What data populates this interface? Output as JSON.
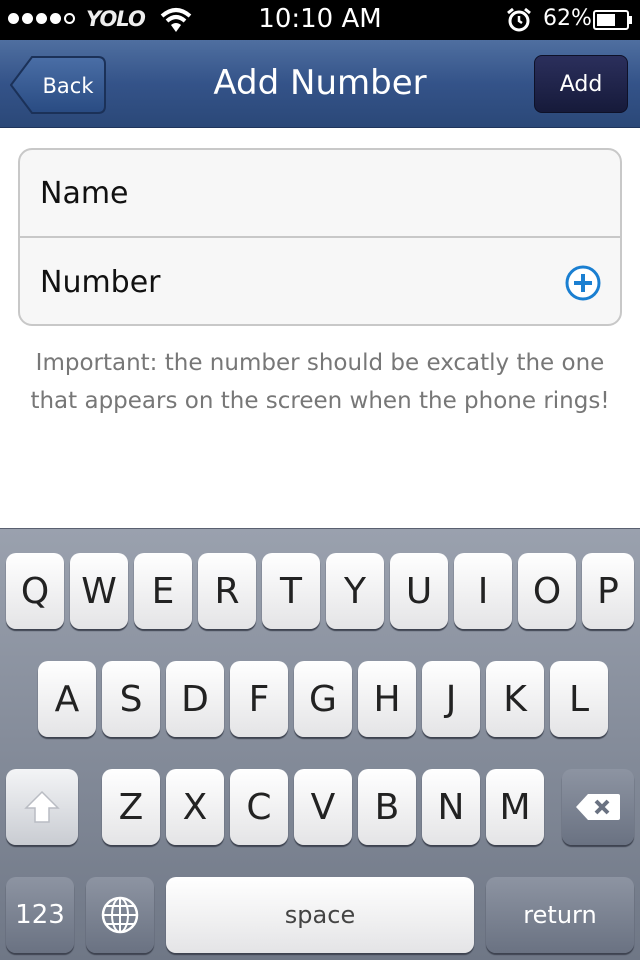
{
  "status_bar": {
    "carrier": "YOLO",
    "time": "10:10 AM",
    "battery_percent": "62%"
  },
  "nav": {
    "back_label": "Back",
    "title": "Add Number",
    "add_label": "Add"
  },
  "form": {
    "name_placeholder": "Name",
    "number_placeholder": "Number"
  },
  "note": "Important: the number should be excatly the one that appears on the screen when the phone rings!",
  "keyboard": {
    "row1": [
      "Q",
      "W",
      "E",
      "R",
      "T",
      "Y",
      "U",
      "I",
      "O",
      "P"
    ],
    "row2": [
      "A",
      "S",
      "D",
      "F",
      "G",
      "H",
      "J",
      "K",
      "L"
    ],
    "row3": [
      "Z",
      "X",
      "C",
      "V",
      "B",
      "N",
      "M"
    ],
    "num_label": "123",
    "space_label": "space",
    "return_label": "return"
  },
  "colors": {
    "nav_bar": "#345389",
    "add_button": "#1f2348",
    "plus_icon": "#1a7fd1"
  }
}
